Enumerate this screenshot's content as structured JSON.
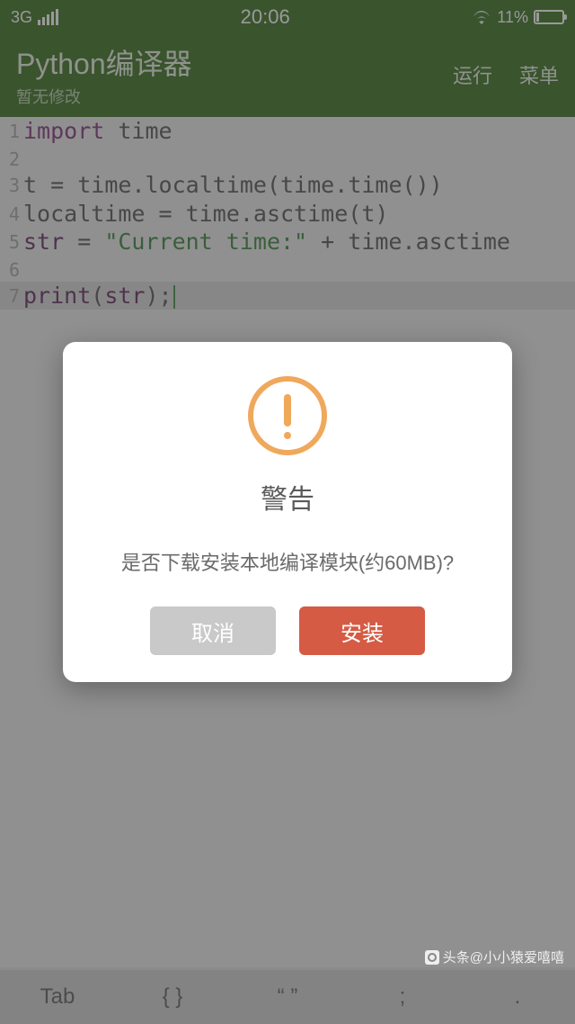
{
  "statusbar": {
    "network": "3G",
    "time": "20:06",
    "battery_pct": "11%"
  },
  "header": {
    "title": "Python编译器",
    "subtitle": "暂无修改",
    "run_label": "运行",
    "menu_label": "菜单"
  },
  "code": {
    "lines": [
      {
        "n": "1",
        "tokens": [
          [
            "kw",
            "import"
          ],
          [
            "ident",
            " time"
          ]
        ]
      },
      {
        "n": "2",
        "tokens": []
      },
      {
        "n": "3",
        "tokens": [
          [
            "ident",
            "t "
          ],
          [
            "punct",
            "= "
          ],
          [
            "ident",
            "time"
          ],
          [
            "punct",
            "."
          ],
          [
            "ident",
            "localtime"
          ],
          [
            "punct",
            "("
          ],
          [
            "ident",
            "time"
          ],
          [
            "punct",
            "."
          ],
          [
            "ident",
            "time"
          ],
          [
            "punct",
            "())"
          ]
        ]
      },
      {
        "n": "4",
        "tokens": [
          [
            "ident",
            "localtime "
          ],
          [
            "punct",
            "= "
          ],
          [
            "ident",
            "time"
          ],
          [
            "punct",
            "."
          ],
          [
            "ident",
            "asctime"
          ],
          [
            "punct",
            "("
          ],
          [
            "ident",
            "t"
          ],
          [
            "punct",
            ")"
          ]
        ]
      },
      {
        "n": "5",
        "tokens": [
          [
            "name",
            "str"
          ],
          [
            "ident",
            " "
          ],
          [
            "punct",
            "= "
          ],
          [
            "str",
            "\"Current time:\""
          ],
          [
            "ident",
            " "
          ],
          [
            "punct",
            "+ "
          ],
          [
            "ident",
            "time"
          ],
          [
            "punct",
            "."
          ],
          [
            "ident",
            "asctime"
          ]
        ]
      },
      {
        "n": "6",
        "tokens": []
      },
      {
        "n": "7",
        "tokens": [
          [
            "name",
            "print"
          ],
          [
            "punct",
            "("
          ],
          [
            "name",
            "str"
          ],
          [
            "punct",
            ");"
          ]
        ],
        "hl": true,
        "cursor": true
      }
    ]
  },
  "keyrow": {
    "k1": "Tab",
    "k2": "{ }",
    "k3": "“ ”",
    "k4": ";",
    "k5": "."
  },
  "dialog": {
    "title": "警告",
    "message": "是否下载安装本地编译模块(约60MB)?",
    "cancel_label": "取消",
    "ok_label": "安装"
  },
  "watermark": {
    "text": "头条@小小猿爱嘻嘻"
  }
}
